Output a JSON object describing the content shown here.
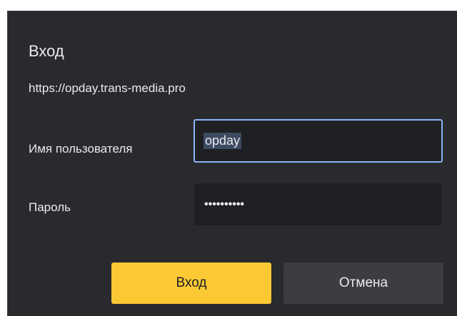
{
  "dialog": {
    "title": "Вход",
    "origin": "https://opday.trans-media.pro"
  },
  "form": {
    "username_label": "Имя пользователя",
    "username_value": "opday",
    "password_label": "Пароль",
    "password_mask": "••••••••••"
  },
  "buttons": {
    "login_label": "Вход",
    "cancel_label": "Отмена"
  },
  "colors": {
    "dialog_bg": "#292a2d",
    "input_bg": "#1f2023",
    "focus_border": "#8ab4f8",
    "primary_button": "#fcc934",
    "secondary_button": "#3c3d41"
  }
}
